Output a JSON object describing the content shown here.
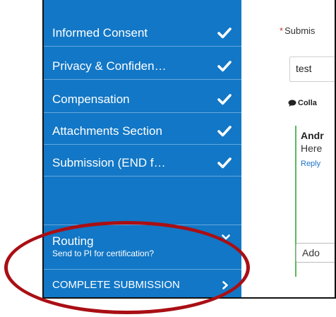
{
  "sidebar": {
    "items": [
      {
        "label": "Informed Consent",
        "status_icon": "check-icon"
      },
      {
        "label": "Privacy & Confiden…",
        "status_icon": "check-icon"
      },
      {
        "label": "Compensation",
        "status_icon": "check-icon"
      },
      {
        "label": "Attachments Section",
        "status_icon": "check-icon"
      },
      {
        "label": "Submission (END f…",
        "status_icon": "check-icon"
      }
    ],
    "routing": {
      "title": "Routing",
      "subtitle": "Send to PI for certification?"
    },
    "complete_label": "COMPLETE SUBMISSION",
    "background_color": "#1277c6"
  },
  "main": {
    "required_marker": "*",
    "field_label": "Submis",
    "input_value": "test",
    "collab_label": "Colla",
    "comment": {
      "author": "Andr",
      "text": "Here",
      "reply_label": "Reply"
    },
    "add_button_label": "Ado"
  },
  "annotation_color": "#a90f14"
}
